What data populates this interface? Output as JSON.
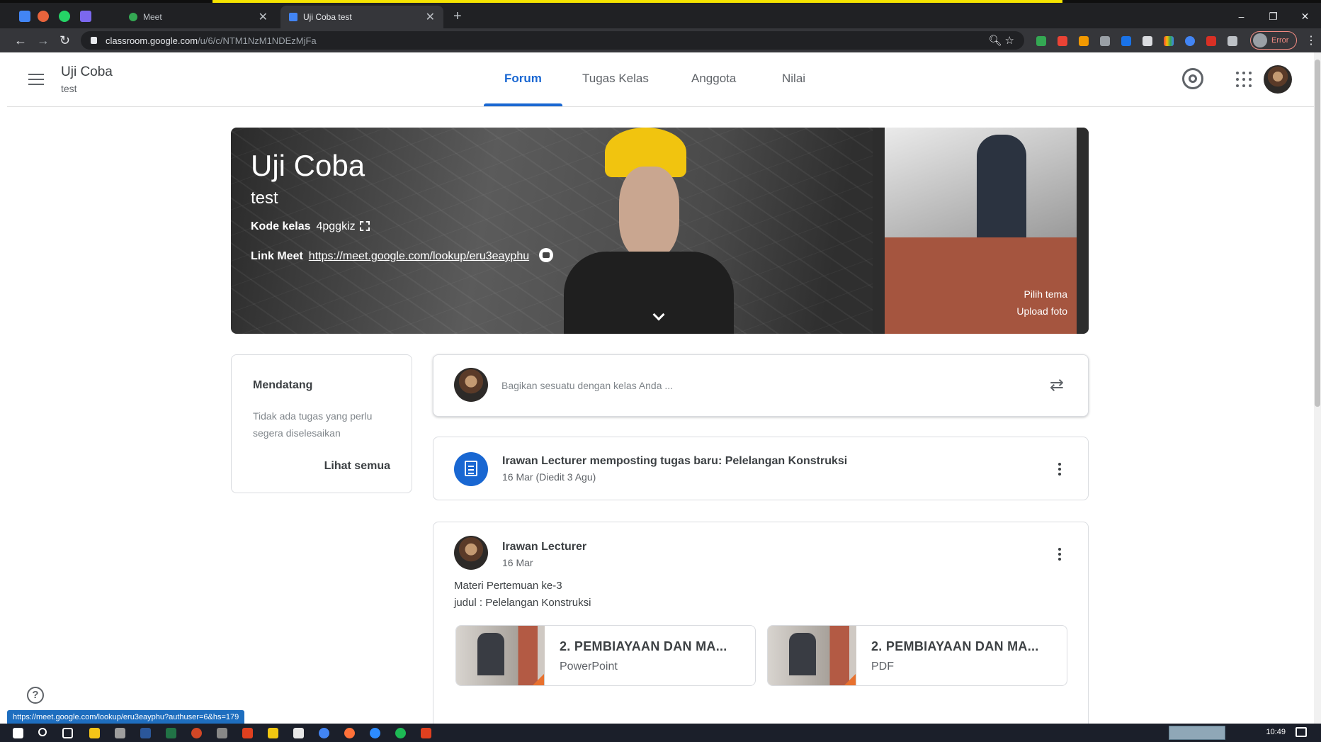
{
  "browser": {
    "tabs": [
      {
        "label": "Meet",
        "active": false
      },
      {
        "label": "Uji Coba test",
        "active": true
      }
    ],
    "pinned_tab_icons": [
      "calendar-icon",
      "wrike-icon",
      "whatsapp-icon",
      "notion-icon"
    ],
    "new_tab": "+",
    "close_glyph": "✕",
    "window_controls": [
      "–",
      "❐",
      "✕"
    ],
    "url_host": "classroom.google.com",
    "url_path": "/u/6/c/NTM1NzM1NDEzMjFa",
    "profile_status": "Error",
    "status_link": "https://meet.google.com/lookup/eru3eayphu?authuser=6&hs=179"
  },
  "header": {
    "class_title": "Uji Coba",
    "class_section": "test",
    "tabs": [
      "Forum",
      "Tugas Kelas",
      "Anggota",
      "Nilai"
    ],
    "active_tab": "Forum"
  },
  "banner": {
    "title": "Uji Coba",
    "subtitle": "test",
    "code_label": "Kode kelas",
    "code_value": "4pggkiz",
    "meet_label": "Link Meet",
    "meet_url": "https://meet.google.com/lookup/eru3eayphu",
    "choose_theme": "Pilih tema",
    "upload_photo": "Upload foto"
  },
  "upcoming": {
    "title": "Mendatang",
    "empty_text": "Tidak ada tugas yang perlu segera diselesaikan",
    "view_all": "Lihat semua"
  },
  "share": {
    "placeholder": "Bagikan sesuatu dengan kelas Anda ..."
  },
  "stream": [
    {
      "type": "assignment",
      "title": "Irawan Lecturer memposting tugas baru: Pelelangan Konstruksi",
      "date": "16 Mar (Diedit 3 Agu)"
    },
    {
      "type": "post",
      "author": "Irawan Lecturer",
      "date": "16 Mar",
      "lines": [
        "Materi Pertemuan ke-3",
        "judul : Pelelangan Konstruksi"
      ],
      "attachments": [
        {
          "name": "2. PEMBIAYAAN DAN MA...",
          "type": "PowerPoint"
        },
        {
          "name": "2. PEMBIAYAAN DAN MA...",
          "type": "PDF"
        }
      ]
    }
  ],
  "help": "?",
  "taskbar": {
    "time": "10:49"
  },
  "colors": {
    "accent": "#1967d2",
    "browser_dark": "#202124",
    "status_blue": "#1e6ebf"
  }
}
